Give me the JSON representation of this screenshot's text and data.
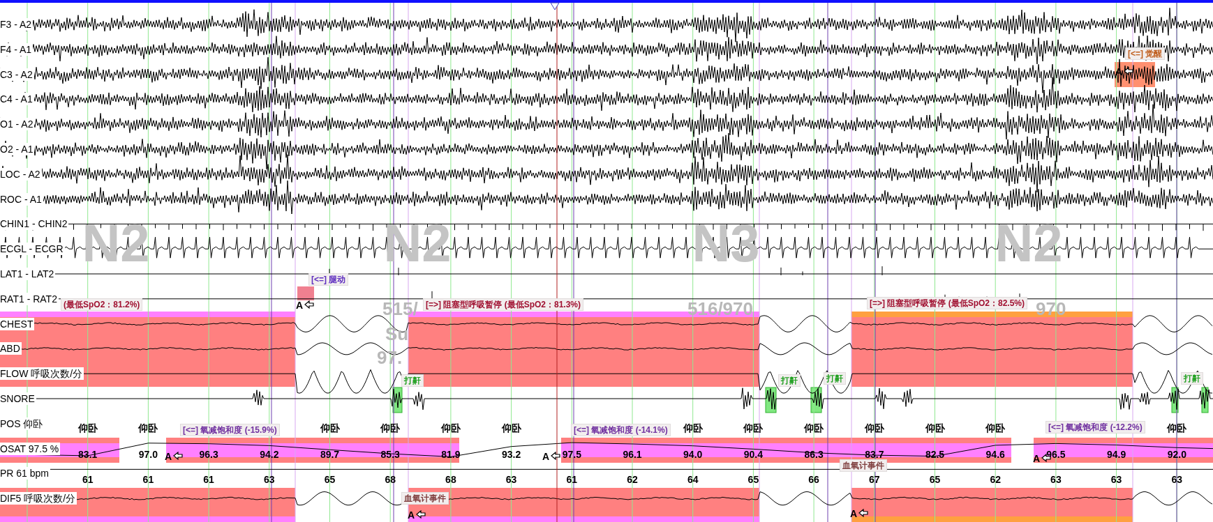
{
  "channels": [
    {
      "label": "F3 - A2",
      "kind": "eeg"
    },
    {
      "label": "F4 - A1",
      "kind": "eeg"
    },
    {
      "label": "C3 - A2",
      "kind": "eeg"
    },
    {
      "label": "C4 - A1",
      "kind": "eeg"
    },
    {
      "label": "O1 - A2",
      "kind": "eeg"
    },
    {
      "label": "O2 - A1",
      "kind": "eeg"
    },
    {
      "label": "LOC - A2",
      "kind": "eeg"
    },
    {
      "label": "ROC - A1",
      "kind": "eeg"
    },
    {
      "label": "CHIN1 - CHIN2",
      "kind": "chin"
    },
    {
      "label": "ECGL - ECGR",
      "kind": "ecg"
    },
    {
      "label": "LAT1 - LAT2",
      "kind": "limb"
    },
    {
      "label": "RAT1 - RAT2",
      "kind": "limb"
    },
    {
      "label": "CHEST",
      "kind": "effort"
    },
    {
      "label": "ABD",
      "kind": "effort"
    },
    {
      "label": "FLOW 呼吸次数/分",
      "kind": "flow"
    },
    {
      "label": "SNORE",
      "kind": "snore"
    },
    {
      "label": "POS 仰卧",
      "kind": "position",
      "values": [
        "仰卧",
        "仰卧",
        "仰卧",
        "仰卧",
        "仰卧",
        "仰卧",
        "仰卧",
        "仰卧",
        "仰卧",
        "仰卧",
        "仰卧",
        "仰卧",
        "仰卧"
      ]
    },
    {
      "label": "OSAT 97.5 %",
      "kind": "saturation",
      "values": [
        "83.1",
        "97.0",
        "96.3",
        "94.2",
        "89.7",
        "85.3",
        "81.9",
        "93.2",
        "97.5",
        "96.1",
        "94.0",
        "90.4",
        "86.3",
        "83.7",
        "82.5",
        "94.6",
        "96.5",
        "94.9",
        "92.0"
      ]
    },
    {
      "label": "PR 61 bpm",
      "kind": "pulse",
      "values": [
        "61",
        "61",
        "61",
        "63",
        "65",
        "68",
        "68",
        "63",
        "61",
        "62",
        "64",
        "65",
        "66",
        "67",
        "65",
        "62",
        "63",
        "63",
        "63"
      ]
    },
    {
      "label": "DIF5 呼吸次数/分",
      "kind": "effort"
    }
  ],
  "stages": [
    "N2",
    "N2",
    "N3",
    "N2"
  ],
  "epoch_labels": [
    "515/",
    "516/970",
    "970"
  ],
  "epoch_details": [
    "Su",
    "97."
  ],
  "respiratory_events": [
    {
      "label": "(最低SpO2：81.2%)",
      "color": "#ff80ff"
    },
    {
      "label": "[=>] 阻塞型呼吸暂停 (最低SpO2：81.3%)",
      "color": "#ff80ff"
    },
    {
      "label": "[=>] 阻塞型呼吸暂停 (最低SpO2：82.5%)",
      "color": "#ffa040"
    }
  ],
  "desaturation_events": [
    {
      "label": "[<=] 氧减饱和度 (-15.9%)"
    },
    {
      "label": "[<=] 氧减饱和度 (-14.1%)"
    },
    {
      "label": "[<=] 氧减饱和度 (-12.2%)"
    }
  ],
  "snore_events": [
    {
      "label": "打鼾"
    },
    {
      "label": "打鼾"
    },
    {
      "label": "打鼾"
    },
    {
      "label": "打鼾"
    }
  ],
  "limb_event": {
    "label": "[<=] 腿动"
  },
  "arousal_event": {
    "label": "[<=] 觉醒"
  },
  "oximeter_events": [
    {
      "label": "血氧计事件"
    },
    {
      "label": "血氧计事件"
    }
  ],
  "markers": [
    "A",
    "A",
    "A",
    "A",
    "A",
    "A",
    "A"
  ]
}
